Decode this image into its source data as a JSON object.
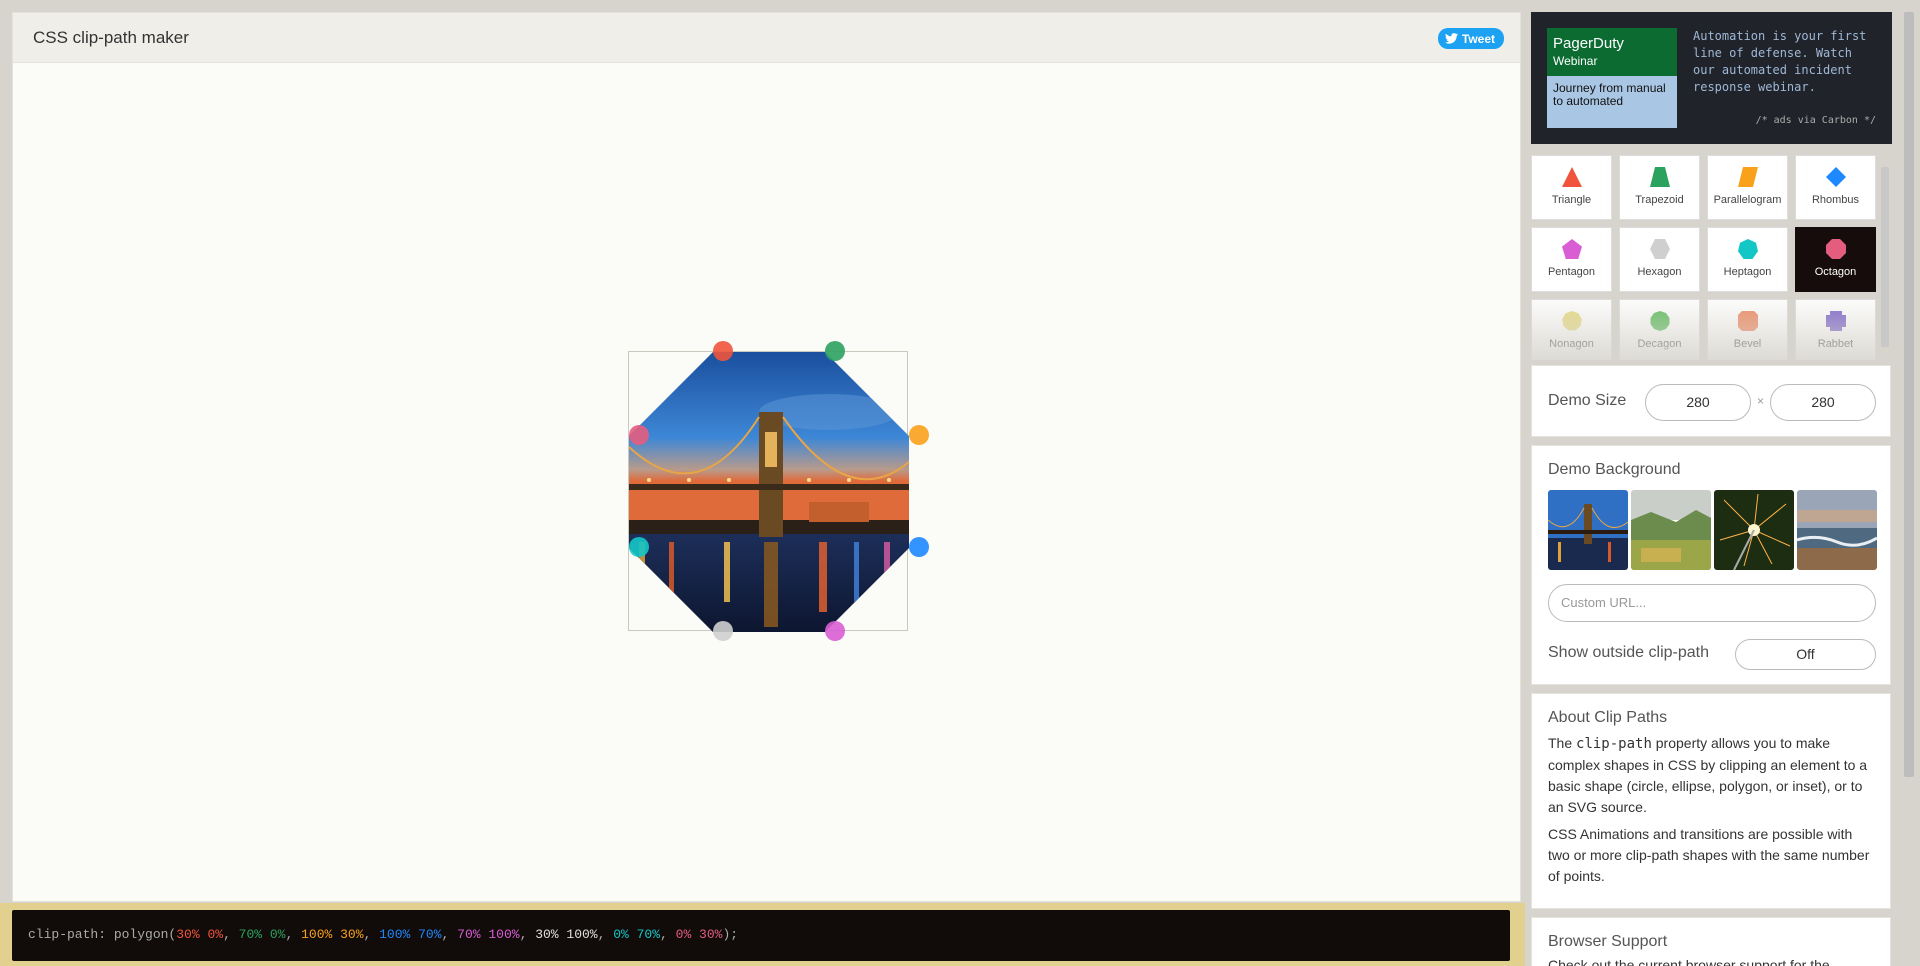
{
  "app": {
    "title": "CSS clip-path maker",
    "tweet_label": "Tweet"
  },
  "ad": {
    "brand": "PagerDuty",
    "sub": "Webinar",
    "card_text": "Journey from manual to automated",
    "text": "Automation is your first line of defense. Watch our automated incident response webinar.",
    "via": "/* ads via Carbon */"
  },
  "shapes": [
    {
      "label": "Triangle",
      "color": "#f0543c",
      "icon": "triangle-icon"
    },
    {
      "label": "Trapezoid",
      "color": "#2ca25f",
      "icon": "trapezoid-icon"
    },
    {
      "label": "Parallelogram",
      "color": "#f9a11b",
      "icon": "parallelogram-icon"
    },
    {
      "label": "Rhombus",
      "color": "#1e88ff",
      "icon": "rhombus-icon"
    },
    {
      "label": "Pentagon",
      "color": "#d95ed4",
      "icon": "pentagon-icon"
    },
    {
      "label": "Hexagon",
      "color": "#cfcfcf",
      "icon": "hexagon-icon"
    },
    {
      "label": "Heptagon",
      "color": "#14c7c7",
      "icon": "heptagon-icon"
    },
    {
      "label": "Octagon",
      "color": "#e45d7f",
      "icon": "octagon-icon",
      "active": true
    },
    {
      "label": "Nonagon",
      "color": "#e8dc86",
      "icon": "nonagon-icon"
    },
    {
      "label": "Decagon",
      "color": "#5fbd5f",
      "icon": "decagon-icon"
    },
    {
      "label": "Bevel",
      "color": "#ef8a63",
      "icon": "bevel-icon"
    },
    {
      "label": "Rabbet",
      "color": "#7f66cc",
      "icon": "rabbet-icon"
    }
  ],
  "size": {
    "label": "Demo Size",
    "width": "280",
    "height": "280",
    "separator": "×"
  },
  "background": {
    "title": "Demo Background",
    "custom_url_placeholder": "Custom URL...",
    "outside_label": "Show outside clip-path",
    "outside_value": "Off"
  },
  "about": {
    "title": "About Clip Paths",
    "p1_before": "The ",
    "p1_code": "clip-path",
    "p1_after": " property allows you to make complex shapes in CSS by clipping an element to a basic shape (circle, ellipse, polygon, or inset), or to an SVG source.",
    "p2": "CSS Animations and transitions are possible with two or more clip-path shapes with the same number of points."
  },
  "browser": {
    "title": "Browser Support",
    "text": "Check out the current browser support for the"
  },
  "code": {
    "prop": "clip-path:",
    "fn_open": "polygon(",
    "points": [
      {
        "text": "30% 0%",
        "color": "#f0543c"
      },
      {
        "text": "70% 0%",
        "color": "#2ca25f"
      },
      {
        "text": "100% 30%",
        "color": "#f9a11b"
      },
      {
        "text": "100% 70%",
        "color": "#1e88ff"
      },
      {
        "text": "70% 100%",
        "color": "#d95ed4"
      },
      {
        "text": "30% 100%",
        "color": "#e0e0e0"
      },
      {
        "text": "0% 70%",
        "color": "#14c7c7"
      },
      {
        "text": "0% 30%",
        "color": "#e45d7f"
      }
    ],
    "fn_close": ");"
  }
}
